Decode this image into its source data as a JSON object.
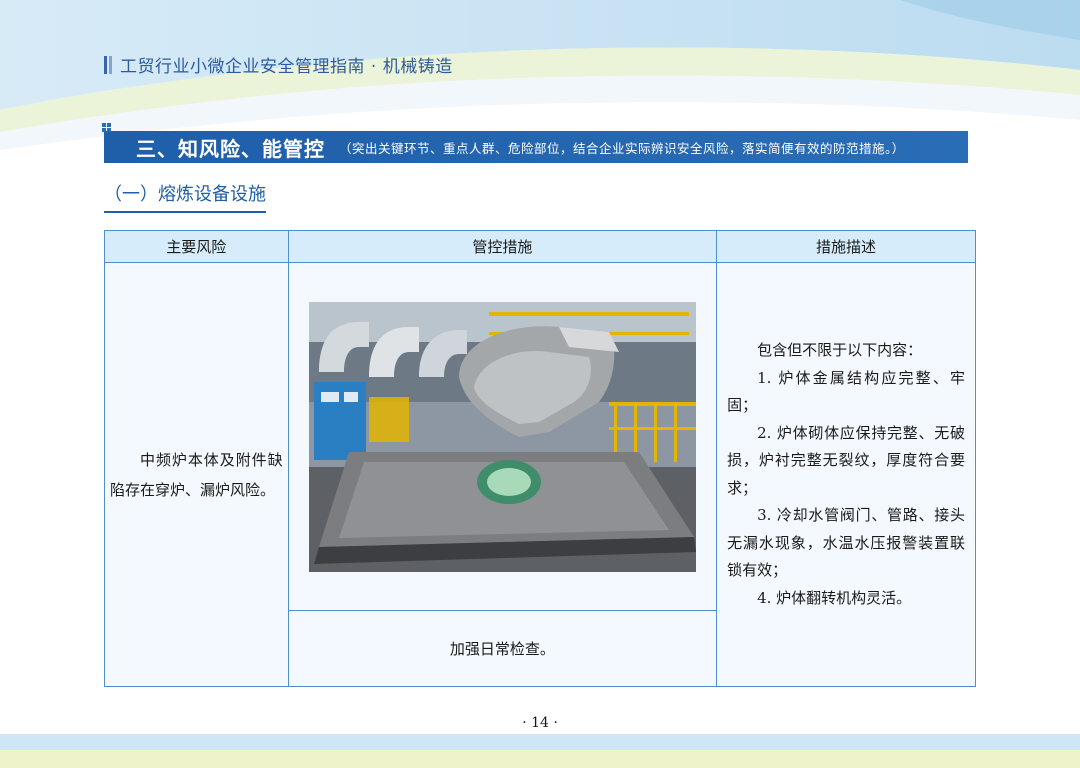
{
  "header": {
    "title": "工贸行业小微企业安全管理指南 · 机械铸造"
  },
  "section": {
    "title": "三、知风险、能管控",
    "note": "（突出关键环节、重点人群、危险部位，结合企业实际辨识安全风险，落实简便有效的防范措施。）"
  },
  "subsection": {
    "title": "（一）熔炼设备设施"
  },
  "table": {
    "headers": [
      "主要风险",
      "管控措施",
      "措施描述"
    ],
    "risk": "中频炉本体及附件缺陷存在穿炉、漏炉风险。",
    "control_text": "加强日常检查。",
    "description": [
      "包含但不限于以下内容：",
      "1. 炉体金属结构应完整、牢固；",
      "2. 炉体砌体应保持完整、无破损，炉衬完整无裂纹，厚度符合要求；",
      "3. 冷却水管阀门、管路、接头无漏水现象，水温水压报警装置联锁有效；",
      "4. 炉体翻转机构灵活。"
    ]
  },
  "page": {
    "number": "· 14 ·"
  },
  "colors": {
    "brand_blue": "#1f5ea8",
    "header_text": "#2d5aa0",
    "table_header_bg": "#d6ecfa",
    "table_border": "#4f8fd0"
  }
}
